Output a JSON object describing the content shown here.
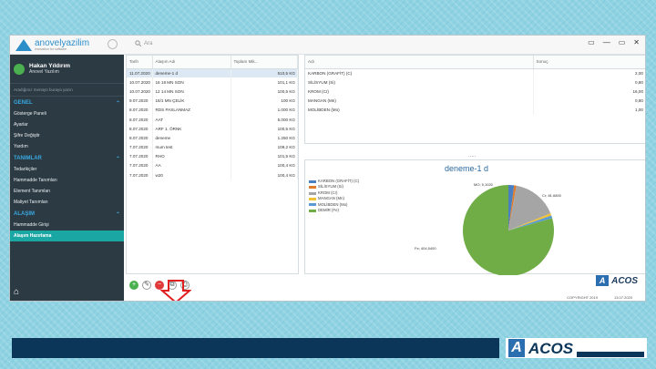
{
  "header": {
    "brand": "anovelyazilim",
    "brand_sub": "innovation for software",
    "search_placeholder": "Ara",
    "window_controls": [
      "▭",
      "—",
      "▭",
      "✕"
    ]
  },
  "user": {
    "name": "Hakan Yıldırım",
    "role": "Anovel Yazılım"
  },
  "quick_search_placeholder": "Aradığınız menüyü buraya yazın",
  "sidebar": {
    "sections": [
      {
        "title": "GENEL",
        "items": [
          "Gösterge Paneli",
          "Ayarlar",
          "Şifre Değiştir",
          "Yardım"
        ]
      },
      {
        "title": "TANIMLAR",
        "items": [
          "Tedarikçiler",
          "Hammadde Tanımları",
          "Element Tanımları",
          "Maliyet Tanımları"
        ]
      },
      {
        "title": "ALAŞIM",
        "items": [
          "Hammadde Girişi",
          "Alaşım Hazırlama"
        ]
      }
    ],
    "active_item": "Alaşım Hazırlama"
  },
  "table": {
    "headers": [
      "Tarih",
      "Alaşım Adı",
      "Toplam Mik..."
    ],
    "rows": [
      [
        "11.07.2020",
        "deneme-1 d",
        "510,5 KG"
      ],
      [
        "10.07.2020",
        "16 18 MN SON",
        "101,1 KG"
      ],
      [
        "10.07.2020",
        "12 14 MN SON",
        "100,5 KG"
      ],
      [
        "9.07.2020",
        "18/1 MN ÇELİK",
        "100 KG"
      ],
      [
        "8.07.2020",
        "RDS PASLANMAZ",
        "1.000 KG"
      ],
      [
        "8.07.2020",
        "AAT",
        "5.000 KG"
      ],
      [
        "8.07.2020",
        "ARF 1. ÖRNK",
        "100,5 KG"
      ],
      [
        "8.07.2020",
        "deneme",
        "1.250 KG"
      ],
      [
        "7.07.2020",
        "mum test",
        "109,2 KG"
      ],
      [
        "7.07.2020",
        "RHO",
        "101,5 KG"
      ],
      [
        "7.07.2020",
        "AA",
        "100,4 KG"
      ],
      [
        "7.07.2020",
        "w20",
        "100,4 KG"
      ]
    ]
  },
  "detail": {
    "headers": [
      "Adı",
      "Sonuç"
    ],
    "rows": [
      [
        "KARBON (GRAFİT) (C)",
        "2,00"
      ],
      [
        "SİLİSYUM (Si)",
        "0,80"
      ],
      [
        "KROM (Cr)",
        "16,00"
      ],
      [
        "MANGAN (Mn)",
        "0,80"
      ],
      [
        "MOLİBDEN (Mo)",
        "1,00"
      ]
    ]
  },
  "chart_data": {
    "type": "pie",
    "title": "deneme-1 d",
    "categories": [
      "KARBON (GRAFİT) (C)",
      "SİLİSYUM (Si)",
      "KROM (Cr)",
      "MANGAN (Mn)",
      "MOLİBDEN (Mo)",
      "DEMİR (Fe)"
    ],
    "values": [
      10.21,
      4.08,
      81.68,
      4.08,
      5.1,
      404.54
    ],
    "colors": [
      "#4a7fc1",
      "#e07b2c",
      "#a5a5a5",
      "#f1c232",
      "#5b9bd5",
      "#70ad47"
    ],
    "data_labels": [
      "MO; 5,1020",
      "Fe; 404,5400",
      "Cr; 81,6800"
    ]
  },
  "footer": {
    "copyright": "COPYRIGHT 2019",
    "date": "13.07.2020",
    "brand": "ACOS"
  }
}
